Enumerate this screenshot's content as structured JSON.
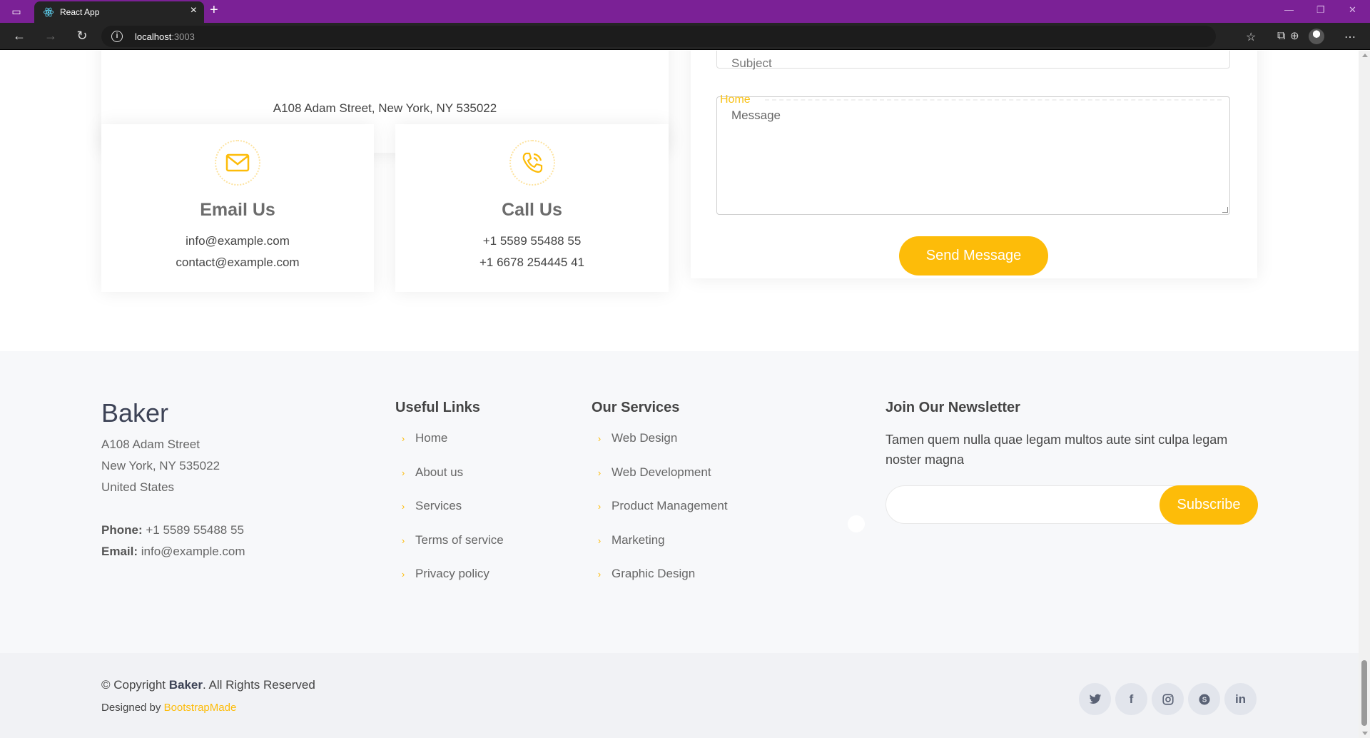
{
  "browser": {
    "tab_title": "React App",
    "url_host": "localhost",
    "url_port": ":3003"
  },
  "contact": {
    "address": "A108 Adam Street, New York, NY 535022",
    "email_title": "Email Us",
    "emails": [
      "info@example.com",
      "contact@example.com"
    ],
    "call_title": "Call Us",
    "phones": [
      "+1 5589 55488 55",
      "+1 6678 254445 41"
    ]
  },
  "form": {
    "subject_placeholder": "Subject",
    "message_placeholder": "Message",
    "floating_label": "Home",
    "send_label": "Send Message"
  },
  "footer": {
    "brand": "Baker",
    "address_lines": [
      "A108 Adam Street",
      "New York, NY 535022",
      "United States"
    ],
    "phone_label": "Phone:",
    "phone": "+1 5589 55488 55",
    "email_label": "Email:",
    "email": "info@example.com",
    "useful_links": {
      "title": "Useful Links",
      "items": [
        "Home",
        "About us",
        "Services",
        "Terms of service",
        "Privacy policy"
      ]
    },
    "services": {
      "title": "Our Services",
      "items": [
        "Web Design",
        "Web Development",
        "Product Management",
        "Marketing",
        "Graphic Design"
      ]
    },
    "newsletter": {
      "title": "Join Our Newsletter",
      "text": "Tamen quem nulla quae legam multos aute sint culpa legam noster magna",
      "input_value": "",
      "subscribe_label": "Subscribe"
    },
    "copyright_prefix": "© Copyright ",
    "copyright_brand": "Baker",
    "copyright_suffix": ". All Rights Reserved",
    "designed_by": "Designed by ",
    "designer": "BootstrapMade",
    "socials": [
      "twitter-icon",
      "facebook-icon",
      "instagram-icon",
      "skype-icon",
      "linkedin-icon"
    ]
  },
  "colors": {
    "accent": "#fdbc09",
    "browser_tabbar": "#7b2196",
    "footer_bg": "#f7f8fa"
  }
}
